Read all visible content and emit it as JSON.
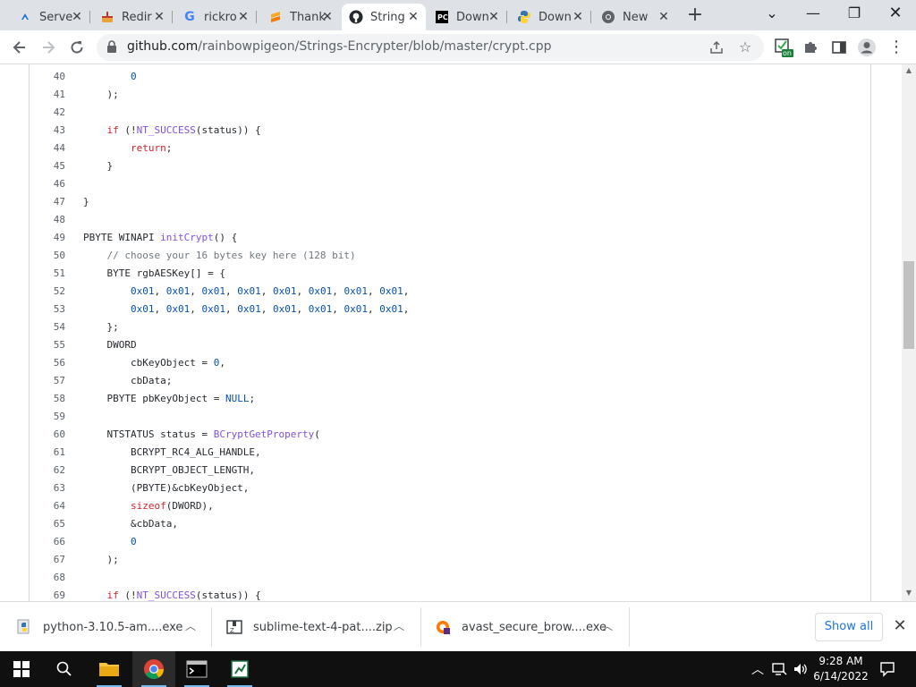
{
  "browser": {
    "tabs": [
      {
        "title": "Serve",
        "favicon": "cloud-blue-icon",
        "active": false
      },
      {
        "title": "Redir",
        "favicon": "cake-icon",
        "active": false
      },
      {
        "title": "rickro",
        "favicon": "google-g-icon",
        "active": false
      },
      {
        "title": "Thank",
        "favicon": "sublime-icon",
        "active": false
      },
      {
        "title": "String",
        "favicon": "github-icon",
        "active": true
      },
      {
        "title": "Down",
        "favicon": "pycharm-icon",
        "active": false
      },
      {
        "title": "Down",
        "favicon": "python-icon",
        "active": false
      },
      {
        "title": "New",
        "favicon": "chrome-icon",
        "active": false
      }
    ],
    "url_host": "github.com",
    "url_path": "/rainbowpigeon/Strings-Encrypter/blob/master/crypt.cpp",
    "extension_badge": "on"
  },
  "code": {
    "lines": [
      {
        "n": "40",
        "tokens": [
          [
            "        ",
            "plain"
          ],
          [
            "0",
            "num"
          ]
        ]
      },
      {
        "n": "41",
        "tokens": [
          [
            "    );",
            "plain"
          ]
        ]
      },
      {
        "n": "42",
        "tokens": []
      },
      {
        "n": "43",
        "tokens": [
          [
            "    ",
            "plain"
          ],
          [
            "if",
            "kw"
          ],
          [
            " (!",
            "plain"
          ],
          [
            "NT_SUCCESS",
            "fn"
          ],
          [
            "(status)) {",
            "plain"
          ]
        ]
      },
      {
        "n": "44",
        "tokens": [
          [
            "        ",
            "plain"
          ],
          [
            "return",
            "kw"
          ],
          [
            ";",
            "plain"
          ]
        ]
      },
      {
        "n": "45",
        "tokens": [
          [
            "    }",
            "plain"
          ]
        ]
      },
      {
        "n": "46",
        "tokens": []
      },
      {
        "n": "47",
        "tokens": [
          [
            "}",
            "plain"
          ]
        ]
      },
      {
        "n": "48",
        "tokens": []
      },
      {
        "n": "49",
        "tokens": [
          [
            "PBYTE WINAPI ",
            "plain"
          ],
          [
            "initCrypt",
            "fn"
          ],
          [
            "() {",
            "plain"
          ]
        ]
      },
      {
        "n": "50",
        "tokens": [
          [
            "    ",
            "plain"
          ],
          [
            "// choose your 16 bytes key here (128 bit)",
            "com"
          ]
        ]
      },
      {
        "n": "51",
        "tokens": [
          [
            "    BYTE rgbAESKey[] = {",
            "plain"
          ]
        ]
      },
      {
        "n": "52",
        "tokens": [
          [
            "        ",
            "plain"
          ],
          [
            "0x01",
            "num"
          ],
          [
            ", ",
            "plain"
          ],
          [
            "0x01",
            "num"
          ],
          [
            ", ",
            "plain"
          ],
          [
            "0x01",
            "num"
          ],
          [
            ", ",
            "plain"
          ],
          [
            "0x01",
            "num"
          ],
          [
            ", ",
            "plain"
          ],
          [
            "0x01",
            "num"
          ],
          [
            ", ",
            "plain"
          ],
          [
            "0x01",
            "num"
          ],
          [
            ", ",
            "plain"
          ],
          [
            "0x01",
            "num"
          ],
          [
            ", ",
            "plain"
          ],
          [
            "0x01",
            "num"
          ],
          [
            ",",
            "plain"
          ]
        ]
      },
      {
        "n": "53",
        "tokens": [
          [
            "        ",
            "plain"
          ],
          [
            "0x01",
            "num"
          ],
          [
            ", ",
            "plain"
          ],
          [
            "0x01",
            "num"
          ],
          [
            ", ",
            "plain"
          ],
          [
            "0x01",
            "num"
          ],
          [
            ", ",
            "plain"
          ],
          [
            "0x01",
            "num"
          ],
          [
            ", ",
            "plain"
          ],
          [
            "0x01",
            "num"
          ],
          [
            ", ",
            "plain"
          ],
          [
            "0x01",
            "num"
          ],
          [
            ", ",
            "plain"
          ],
          [
            "0x01",
            "num"
          ],
          [
            ", ",
            "plain"
          ],
          [
            "0x01",
            "num"
          ],
          [
            ",",
            "plain"
          ]
        ]
      },
      {
        "n": "54",
        "tokens": [
          [
            "    };",
            "plain"
          ]
        ]
      },
      {
        "n": "55",
        "tokens": [
          [
            "    DWORD",
            "plain"
          ]
        ]
      },
      {
        "n": "56",
        "tokens": [
          [
            "        cbKeyObject = ",
            "plain"
          ],
          [
            "0",
            "num"
          ],
          [
            ",",
            "plain"
          ]
        ]
      },
      {
        "n": "57",
        "tokens": [
          [
            "        cbData;",
            "plain"
          ]
        ]
      },
      {
        "n": "58",
        "tokens": [
          [
            "    PBYTE pbKeyObject = ",
            "plain"
          ],
          [
            "NULL",
            "const"
          ],
          [
            ";",
            "plain"
          ]
        ]
      },
      {
        "n": "59",
        "tokens": []
      },
      {
        "n": "60",
        "tokens": [
          [
            "    NTSTATUS status = ",
            "plain"
          ],
          [
            "BCryptGetProperty",
            "fn"
          ],
          [
            "(",
            "plain"
          ]
        ]
      },
      {
        "n": "61",
        "tokens": [
          [
            "        BCRYPT_RC4_ALG_HANDLE,",
            "plain"
          ]
        ]
      },
      {
        "n": "62",
        "tokens": [
          [
            "        BCRYPT_OBJECT_LENGTH,",
            "plain"
          ]
        ]
      },
      {
        "n": "63",
        "tokens": [
          [
            "        (PBYTE)&cbKeyObject,",
            "plain"
          ]
        ]
      },
      {
        "n": "64",
        "tokens": [
          [
            "        ",
            "plain"
          ],
          [
            "sizeof",
            "kw"
          ],
          [
            "(DWORD),",
            "plain"
          ]
        ]
      },
      {
        "n": "65",
        "tokens": [
          [
            "        &cbData,",
            "plain"
          ]
        ]
      },
      {
        "n": "66",
        "tokens": [
          [
            "        ",
            "plain"
          ],
          [
            "0",
            "num"
          ]
        ]
      },
      {
        "n": "67",
        "tokens": [
          [
            "    );",
            "plain"
          ]
        ]
      },
      {
        "n": "68",
        "tokens": []
      },
      {
        "n": "69",
        "tokens": [
          [
            "    ",
            "plain"
          ],
          [
            "if",
            "kw"
          ],
          [
            " (!",
            "plain"
          ],
          [
            "NT_SUCCESS",
            "fn"
          ],
          [
            "(status)) {",
            "plain"
          ]
        ]
      }
    ]
  },
  "downloads": {
    "items": [
      {
        "name": "python-3.10.5-am....exe",
        "icon": "python-installer-icon"
      },
      {
        "name": "sublime-text-4-pat....zip",
        "icon": "zip-archive-icon"
      },
      {
        "name": "avast_secure_brow....exe",
        "icon": "avast-installer-icon"
      }
    ],
    "show_all": "Show all"
  },
  "taskbar": {
    "time": "9:28 AM",
    "date": "6/14/2022"
  }
}
